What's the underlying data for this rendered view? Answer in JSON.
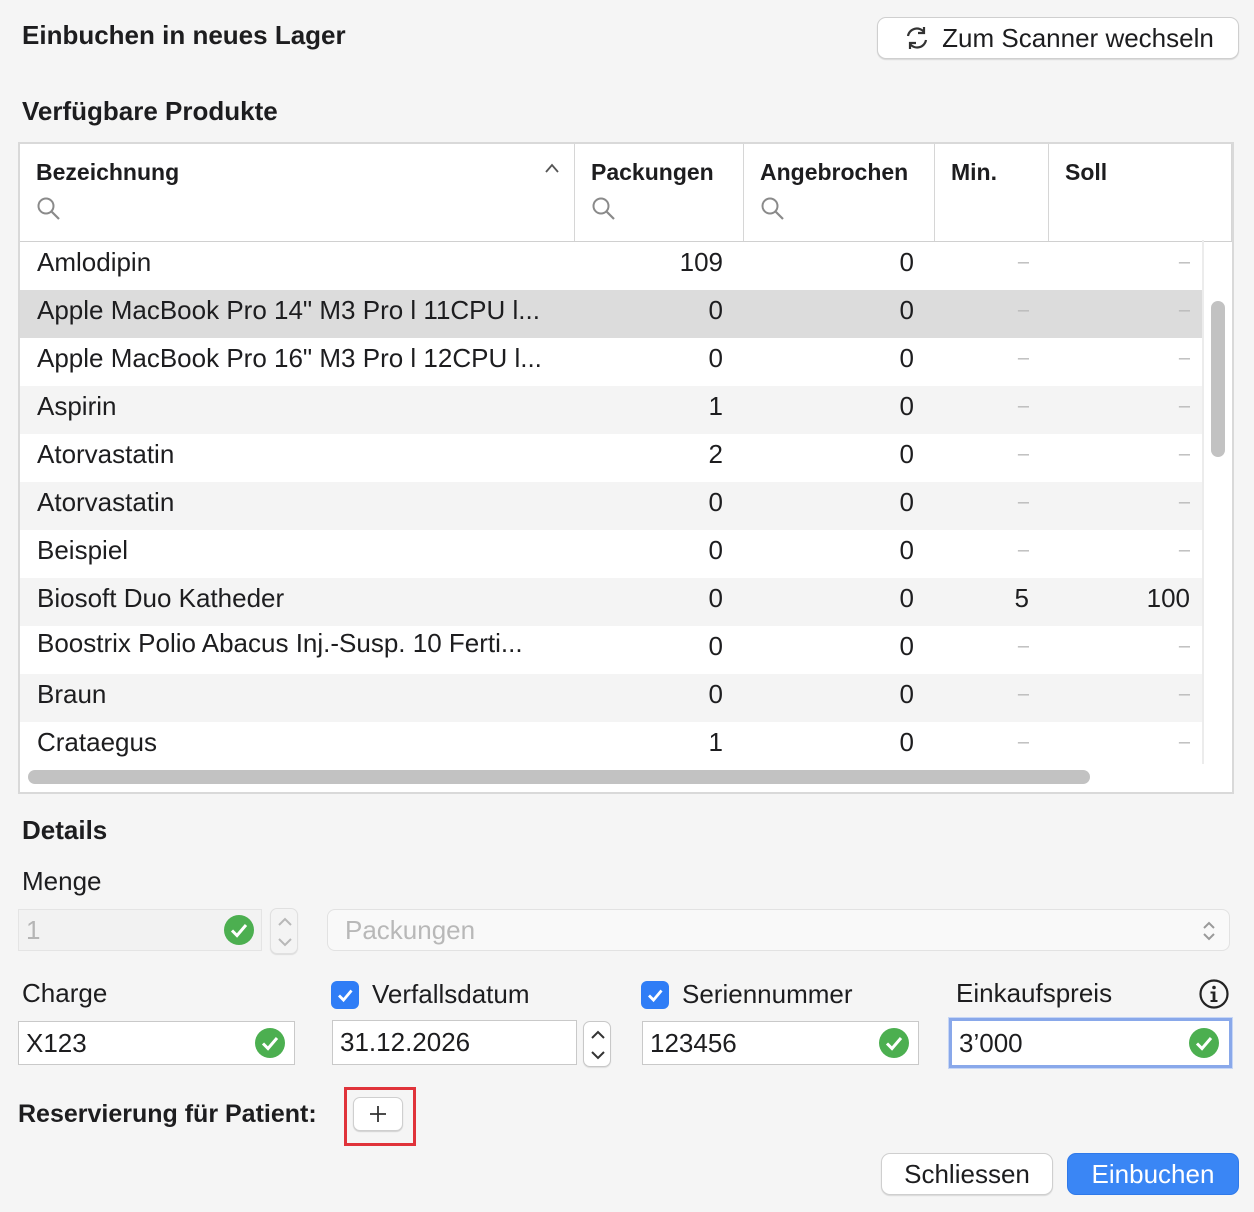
{
  "window": {
    "title": "Einbuchen in neues Lager",
    "scanner_button": "Zum Scanner wechseln"
  },
  "products": {
    "section_title": "Verfügbare Produkte",
    "columns": [
      "Bezeichnung",
      "Packungen",
      "Angebrochen",
      "Min.",
      "Soll"
    ],
    "sort": "Bezeichnung ascending",
    "rows": [
      {
        "name": "Amlodipin",
        "packungen": "109",
        "angebrochen": "0",
        "min": "–",
        "soll": "–"
      },
      {
        "name": "Apple MacBook Pro 14\" M3 Pro l 11CPU l...",
        "packungen": "0",
        "angebrochen": "0",
        "min": "–",
        "soll": "–"
      },
      {
        "name": "Apple MacBook Pro 16\" M3 Pro l 12CPU l...",
        "packungen": "0",
        "angebrochen": "0",
        "min": "–",
        "soll": "–"
      },
      {
        "name": "Aspirin",
        "packungen": "1",
        "angebrochen": "0",
        "min": "–",
        "soll": "–"
      },
      {
        "name": "Atorvastatin",
        "packungen": "2",
        "angebrochen": "0",
        "min": "–",
        "soll": "–"
      },
      {
        "name": "Atorvastatin",
        "packungen": "0",
        "angebrochen": "0",
        "min": "–",
        "soll": "–"
      },
      {
        "name": "Beispiel",
        "packungen": "0",
        "angebrochen": "0",
        "min": "–",
        "soll": "–"
      },
      {
        "name": "Biosoft Duo Katheder",
        "packungen": "0",
        "angebrochen": "0",
        "min": "5",
        "soll": "100"
      },
      {
        "name": "Boostrix Polio Abacus Inj.-Susp. 10 Ferti...",
        "packungen": "0",
        "angebrochen": "0",
        "min": "–",
        "soll": "–"
      },
      {
        "name": "Braun",
        "packungen": "0",
        "angebrochen": "0",
        "min": "–",
        "soll": "–"
      },
      {
        "name": "Crataegus",
        "packungen": "1",
        "angebrochen": "0",
        "min": "–",
        "soll": "–"
      }
    ]
  },
  "details": {
    "section_title": "Details",
    "menge_label": "Menge",
    "menge_value": "1",
    "unit_placeholder": "Packungen",
    "charge_label": "Charge",
    "charge_value": "X123",
    "verfallsdatum_label": "Verfallsdatum",
    "verfallsdatum_value": "31.12.2026",
    "seriennummer_label": "Seriennummer",
    "seriennummer_value": "123456",
    "einkaufspreis_label": "Einkaufspreis",
    "einkaufspreis_value": "3’000",
    "reservation_label": "Reservierung für Patient:"
  },
  "footer": {
    "close_label": "Schliessen",
    "submit_label": "Einbuchen"
  },
  "colors": {
    "accent": "#3a86f5",
    "valid": "#4caf50",
    "highlight": "#e0333a"
  }
}
